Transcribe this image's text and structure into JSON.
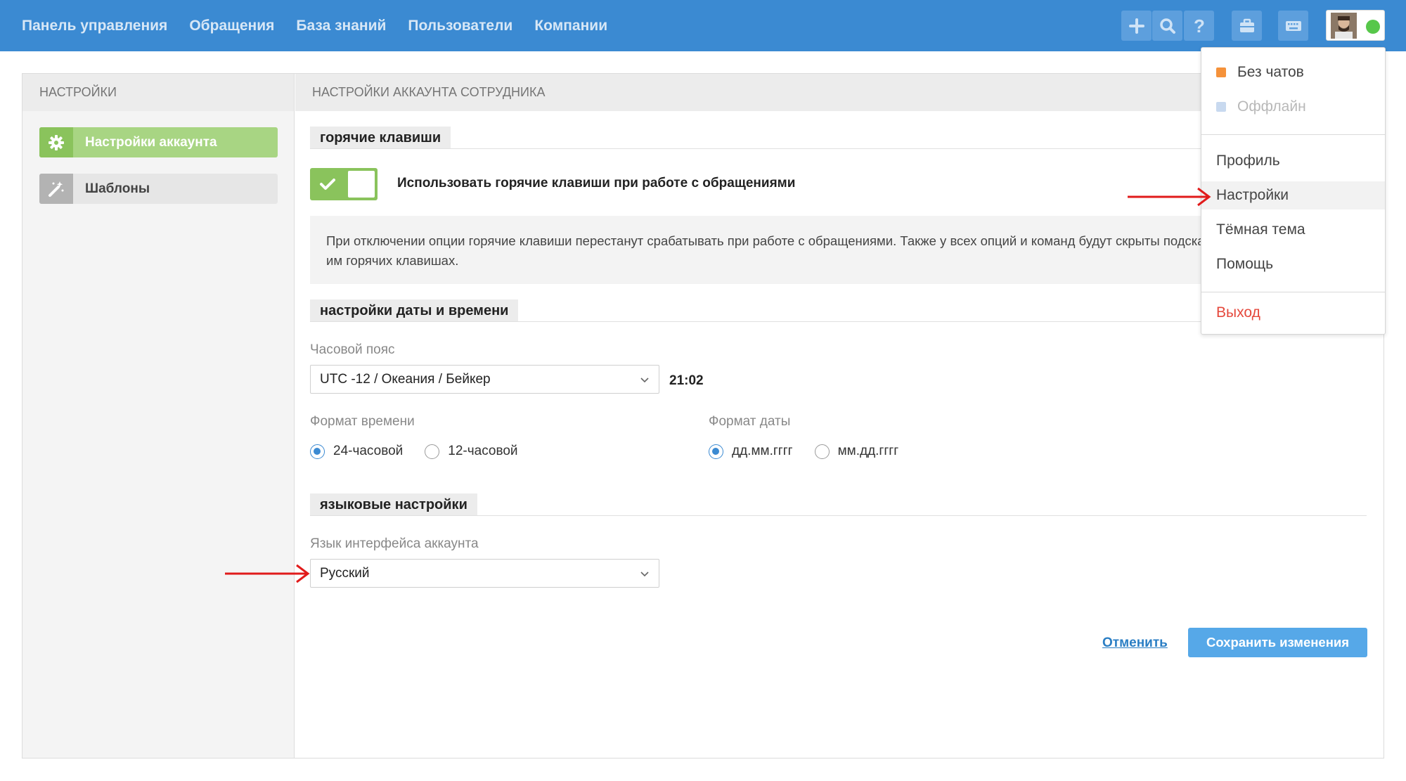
{
  "nav": {
    "items": [
      "Панель управления",
      "Обращения",
      "База знаний",
      "Пользователи",
      "Компании"
    ]
  },
  "toolbar": {
    "icons": [
      "plus-icon",
      "search-icon",
      "help-icon",
      "briefcase-icon",
      "keyboard-icon"
    ]
  },
  "sidebar": {
    "header": "Настройки",
    "items": [
      {
        "label": "Настройки аккаунта",
        "icon": "gear-icon",
        "active": true
      },
      {
        "label": "Шаблоны",
        "icon": "magic-wand-icon",
        "active": false
      }
    ]
  },
  "content": {
    "header": "Настройки аккаунта сотрудника",
    "hotkeys": {
      "section_title": "горячие клавиши",
      "toggle_label": "Использовать горячие клавиши при работе с обращениями",
      "toggle_on": true,
      "note": "При отключении опции горячие клавиши перестанут срабатывать при работе с обращениями. Также у всех опций и команд будут скрыты подсказки соответствующих им горячих клавишах."
    },
    "datetime": {
      "section_title": "настройки даты и времени",
      "timezone_label": "Часовой пояс",
      "timezone_value": "UTC -12 / Океания / Бейкер",
      "current_time": "21:02",
      "time_format_label": "Формат времени",
      "time_format_options": [
        "24-часовой",
        "12-часовой"
      ],
      "time_format_selected": "24-часовой",
      "date_format_label": "Формат даты",
      "date_format_options": [
        "дд.мм.гггг",
        "мм.дд.гггг"
      ],
      "date_format_selected": "дд.мм.гггг"
    },
    "language": {
      "section_title": "языковые настройки",
      "language_label": "Язык интерфейса аккаунта",
      "language_value": "Русский"
    },
    "actions": {
      "cancel_label": "Отменить",
      "save_label": "Сохранить изменения"
    }
  },
  "user_menu": {
    "statuses": [
      {
        "label": "Без чатов",
        "color": "#f5923a"
      },
      {
        "label": "Оффлайн",
        "color": "#c8d9ef"
      }
    ],
    "items": [
      "Профиль",
      "Настройки",
      "Тёмная тема",
      "Помощь"
    ],
    "logout_label": "Выход",
    "highlighted": "Настройки"
  },
  "colors": {
    "topbar": "#3b8ad2",
    "accent_green": "#8ac35c",
    "online_status": "#57c74a",
    "annotation_arrow": "#e11b1b",
    "logout": "#e5483c"
  }
}
